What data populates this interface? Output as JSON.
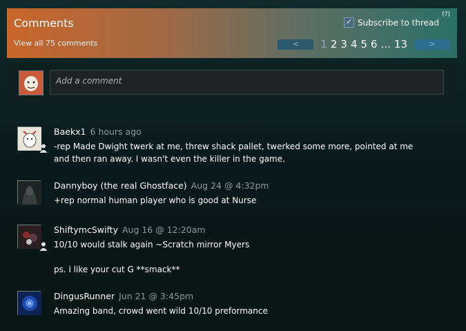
{
  "header": {
    "title": "Comments",
    "view_all": "View all 75 comments",
    "subscribe_label": "Subscribe to thread",
    "help": "(?)",
    "pagination": {
      "prev": "<",
      "next": ">",
      "pages": [
        "1",
        "2",
        "3",
        "4",
        "5",
        "6",
        "...",
        "13"
      ],
      "current": "1"
    }
  },
  "add_comment": {
    "placeholder": "Add a comment"
  },
  "comments": [
    {
      "author": "Baekx1",
      "time": "6 hours ago",
      "text": "-rep Made Dwight twerk at me, threw shack pallet, twerked some more, pointed at me and then ran away. I wasn't even the killer in the game.",
      "friend": true
    },
    {
      "author": "Dannyboy (the real Ghostface)",
      "time": "Aug 24 @ 4:32pm",
      "text": "+rep normal human player who is good at Nurse",
      "friend": false
    },
    {
      "author": "ShiftymcSwifty",
      "time": "Aug 16 @ 12:20am",
      "text": "10/10 would stalk again ~Scratch mirror Myers",
      "text2": "ps. i like your cut G **smack**",
      "friend": true
    },
    {
      "author": "DingusRunner",
      "time": "Jun 21 @ 3:45pm",
      "text": "Amazing band, crowd went wild 10/10 preformance",
      "friend": false
    }
  ]
}
